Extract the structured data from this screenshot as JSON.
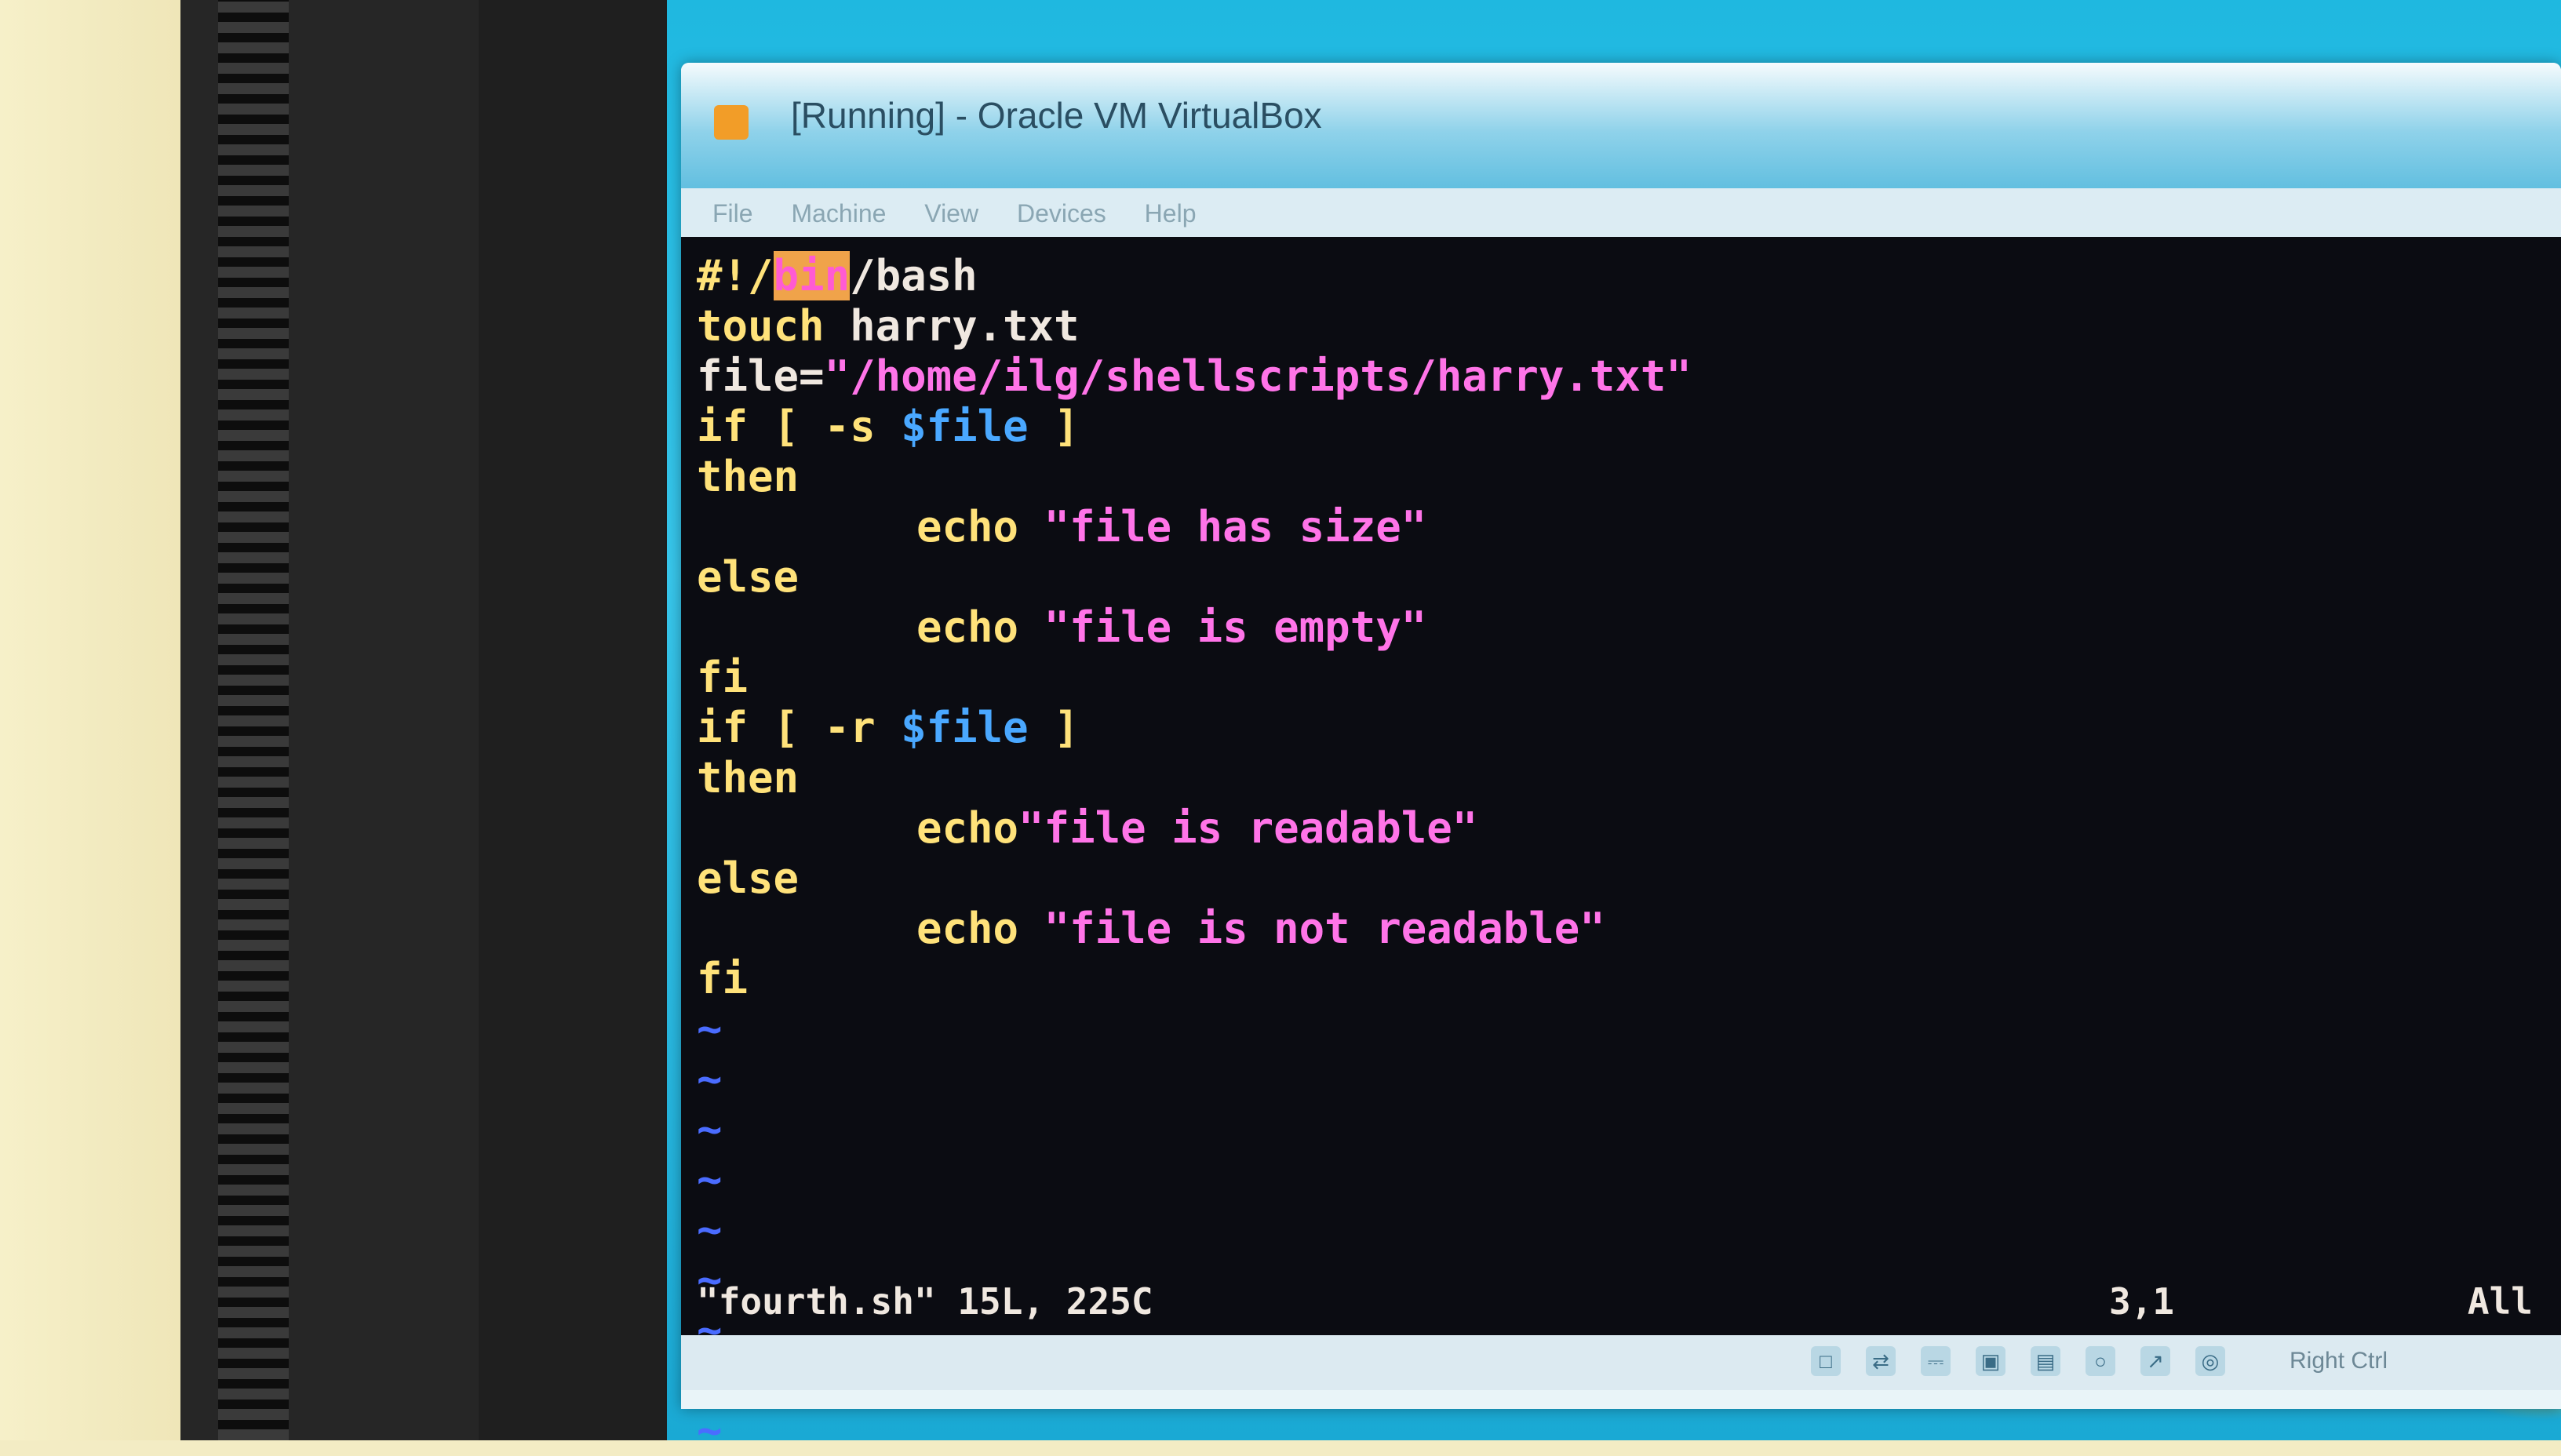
{
  "window": {
    "title": "[Running] - Oracle VM VirtualBox",
    "menu": [
      "File",
      "Machine",
      "View",
      "Devices",
      "Help"
    ]
  },
  "editor": {
    "lines": [
      {
        "parts": [
          {
            "t": "#!/",
            "c": "kw"
          },
          {
            "t": "bin",
            "c": "hl"
          },
          {
            "t": "/bash",
            "c": "plain"
          }
        ]
      },
      {
        "parts": [
          {
            "t": "touch",
            "c": "kw"
          },
          {
            "t": " harry.txt",
            "c": "plain"
          }
        ]
      },
      {
        "parts": [
          {
            "t": "file=",
            "c": "plain"
          },
          {
            "t": "\"/home/ilg/shellscripts/harry.txt\"",
            "c": "str"
          }
        ]
      },
      {
        "parts": [
          {
            "t": "if [ -s ",
            "c": "kw"
          },
          {
            "t": "$file",
            "c": "var"
          },
          {
            "t": " ]",
            "c": "kw"
          }
        ]
      },
      {
        "parts": [
          {
            "t": "then",
            "c": "kw"
          }
        ]
      },
      {
        "indent": true,
        "parts": [
          {
            "t": "echo ",
            "c": "kw"
          },
          {
            "t": "\"file has size\"",
            "c": "str"
          }
        ]
      },
      {
        "parts": [
          {
            "t": "else",
            "c": "kw"
          }
        ]
      },
      {
        "indent": true,
        "parts": [
          {
            "t": "echo ",
            "c": "kw"
          },
          {
            "t": "\"file is empty\"",
            "c": "str"
          }
        ]
      },
      {
        "parts": [
          {
            "t": "fi",
            "c": "kw"
          }
        ]
      },
      {
        "parts": [
          {
            "t": "if [ -r ",
            "c": "kw"
          },
          {
            "t": "$file",
            "c": "var"
          },
          {
            "t": " ]",
            "c": "kw"
          }
        ]
      },
      {
        "parts": [
          {
            "t": "then",
            "c": "kw"
          }
        ]
      },
      {
        "indent": true,
        "parts": [
          {
            "t": "echo",
            "c": "kw"
          },
          {
            "t": "\"file is readable\"",
            "c": "str"
          }
        ]
      },
      {
        "parts": [
          {
            "t": "else",
            "c": "kw"
          }
        ]
      },
      {
        "indent": true,
        "parts": [
          {
            "t": "echo ",
            "c": "kw"
          },
          {
            "t": "\"file is not readable\"",
            "c": "str"
          }
        ]
      },
      {
        "parts": [
          {
            "t": "fi",
            "c": "kw"
          }
        ]
      }
    ],
    "tilde_count": 9,
    "status": {
      "file_info": "\"fourth.sh\" 15L, 225C",
      "cursor": "3,1",
      "scroll": "All"
    }
  },
  "statusbar": {
    "icons": [
      "disk-icon",
      "network-icon",
      "usb-icon",
      "display-icon",
      "shared-folder-icon",
      "capture-icon",
      "mouse-integration-icon",
      "optical-drive-icon"
    ],
    "host_key": "Right Ctrl"
  },
  "colors": {
    "keyword": "#ffe27a",
    "string": "#ff74e8",
    "variable": "#4aa8ff",
    "highlight": "#f0a34a",
    "tilde": "#4a6cff",
    "terminal_bg": "#0b0c12"
  }
}
